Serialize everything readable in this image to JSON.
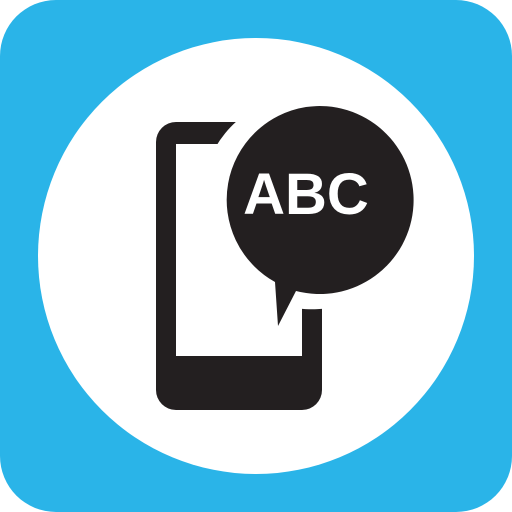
{
  "icon": {
    "name": "phone-speech-bubble-app-icon",
    "bubble_text": "ABC",
    "colors": {
      "background": "#2AB4E8",
      "circle": "#FFFFFF",
      "glyph": "#231F20",
      "bubble_text": "#FFFFFF"
    }
  }
}
